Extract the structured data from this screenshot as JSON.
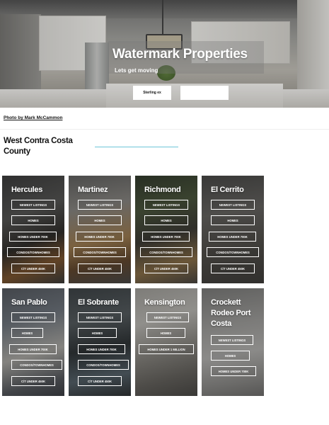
{
  "hero": {
    "title": "Watermark Properties",
    "subtitle": "Lets get moving",
    "primary_button": "Sterling ex",
    "secondary_button": ""
  },
  "credit": "Photo by Mark McCammon",
  "region": {
    "title": "West Contra Costa County"
  },
  "cards": [
    {
      "city": "Hercules",
      "links": [
        "NEWEST LISTINGS",
        "HOMES",
        "HOMES UNDER 700K",
        "CONDOS/TOWNHOMES",
        "C/T UNDER 450K"
      ]
    },
    {
      "city": "Martinez",
      "links": [
        "NEWEST LISTINGS",
        "HOMES",
        "HOMES UNDER 700K",
        "CONDOS/TOWNHOMES",
        "C/T UNDER 450K"
      ]
    },
    {
      "city": "Richmond",
      "links": [
        "NEWEST LISTINGS",
        "HOMES",
        "HOMES UNDER 700K",
        "CONDOS/TOWNHOMES",
        "C/T UNDER 450K"
      ]
    },
    {
      "city": "El Cerrito",
      "links": [
        "NEWEST LISTINGS",
        "HOMES",
        "HOMES UNDER 700K",
        "CONDOS/TOWNHOMES",
        "C/T UNDER 450K"
      ]
    },
    {
      "city": "San Pablo",
      "links": [
        "NEWEST LISTINGS",
        "HOMES",
        "HOMES UNDER 700K",
        "CONDOS/TOWNHOMES",
        "C/T UNDER 450K"
      ]
    },
    {
      "city": "El Sobrante",
      "links": [
        "NEWEST LISTINGS",
        "HOMES",
        "HOMES UNDER 700K",
        "CONDOS/TOWNHOMES",
        "C/T UNDER 450K"
      ]
    },
    {
      "city": "Kensington",
      "links": [
        "NEWEST LISTINGS",
        "HOMES",
        "HOMES UNDER 1 MILLION"
      ]
    },
    {
      "city": "Crockett Rodeo Port Costa",
      "links": [
        "NEWEST LISTINGS",
        "HOMES",
        "HOMES UNDER 700K"
      ]
    }
  ]
}
